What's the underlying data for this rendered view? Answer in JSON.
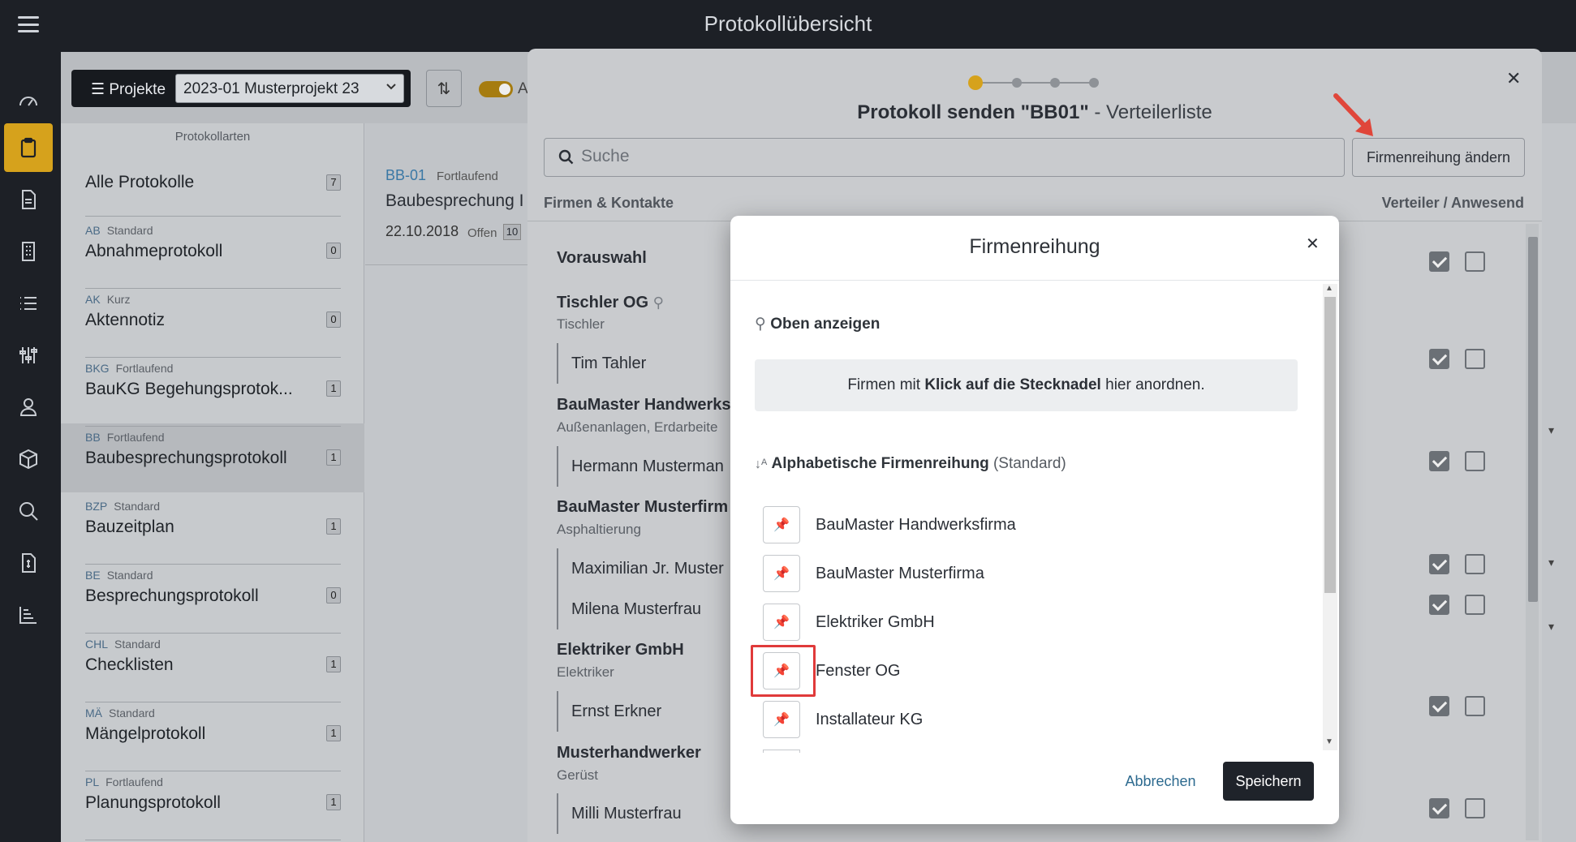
{
  "header": {
    "title": "Protokollübersicht"
  },
  "rail": {
    "items": [
      "dashboard-icon",
      "clipboard-icon",
      "document-icon",
      "building-icon",
      "list-icon",
      "sliders-icon",
      "user-icon",
      "cube-icon",
      "search-icon",
      "invoice-icon",
      "chart-icon"
    ],
    "active_color": "#d6a21c"
  },
  "toolbar": {
    "projekte_label": "Projekte",
    "projekt_value": "2023-01 Musterprojekt 23",
    "toggle_label": "A"
  },
  "list": {
    "header": "Protokollarten",
    "items": [
      {
        "code": "",
        "type": "",
        "name": "Alle Protokolle",
        "count": "7"
      },
      {
        "code": "AB",
        "type": "Standard",
        "name": "Abnahmeprotokoll",
        "count": "0"
      },
      {
        "code": "AK",
        "type": "Kurz",
        "name": "Aktennotiz",
        "count": "0"
      },
      {
        "code": "BKG",
        "type": "Fortlaufend",
        "name": "BauKG Begehungsprotok...",
        "count": "1"
      },
      {
        "code": "BB",
        "type": "Fortlaufend",
        "name": "Baubesprechungsprotokoll",
        "count": "1"
      },
      {
        "code": "BZP",
        "type": "Standard",
        "name": "Bauzeitplan",
        "count": "1"
      },
      {
        "code": "BE",
        "type": "Standard",
        "name": "Besprechungsprotokoll",
        "count": "0"
      },
      {
        "code": "CHL",
        "type": "Standard",
        "name": "Checklisten",
        "count": "1"
      },
      {
        "code": "MÄ",
        "type": "Standard",
        "name": "Mängelprotokoll",
        "count": "1"
      },
      {
        "code": "PL",
        "type": "Fortlaufend",
        "name": "Planungsprotokoll",
        "count": "1"
      }
    ]
  },
  "protocol": {
    "code": "BB-01",
    "type": "Fortlaufend",
    "title": "Baubesprechung I",
    "date": "22.10.2018",
    "status": "Offen",
    "count": "10"
  },
  "send_dialog": {
    "title_bold": "Protokoll senden \"BB01\"",
    "title_rest": " - Verteilerliste",
    "search_placeholder": "Suche",
    "firmen_button": "Firmenreihung ändern",
    "col_left": "Firmen & Kontakte",
    "col_right": "Verteiler / Anwesend",
    "section": "Vorauswahl",
    "companies": [
      {
        "name": "Tischler OG",
        "trade": "Tischler",
        "people": [
          "Tim Tahler"
        ]
      },
      {
        "name": "BauMaster Handwerks",
        "trade": "Außenanlagen, Erdarbeite",
        "people": [
          "Hermann Musterman"
        ]
      },
      {
        "name": "BauMaster Musterfirm",
        "trade": "Asphaltierung",
        "people": [
          "Maximilian Jr. Muster",
          "Milena Musterfrau"
        ]
      },
      {
        "name": "Elektriker GmbH",
        "trade": "Elektriker",
        "people": [
          "Ernst Erkner"
        ]
      },
      {
        "name": "Musterhandwerker",
        "trade": "Gerüst",
        "people": [
          "Milli Musterfrau"
        ]
      }
    ]
  },
  "order_dialog": {
    "title": "Firmenreihung",
    "pinned_label": "Oben anzeigen",
    "hint_pre": "Firmen mit ",
    "hint_bold": "Klick auf die Stecknadel",
    "hint_post": " hier anordnen.",
    "alpha_bold": "Alphabetische Firmenreihung",
    "alpha_rest": " (Standard)",
    "firms": [
      "BauMaster Handwerksfirma",
      "BauMaster Musterfirma",
      "Elektriker GmbH",
      "Fenster OG",
      "Installateur KG"
    ],
    "cancel": "Abbrechen",
    "save": "Speichern"
  }
}
